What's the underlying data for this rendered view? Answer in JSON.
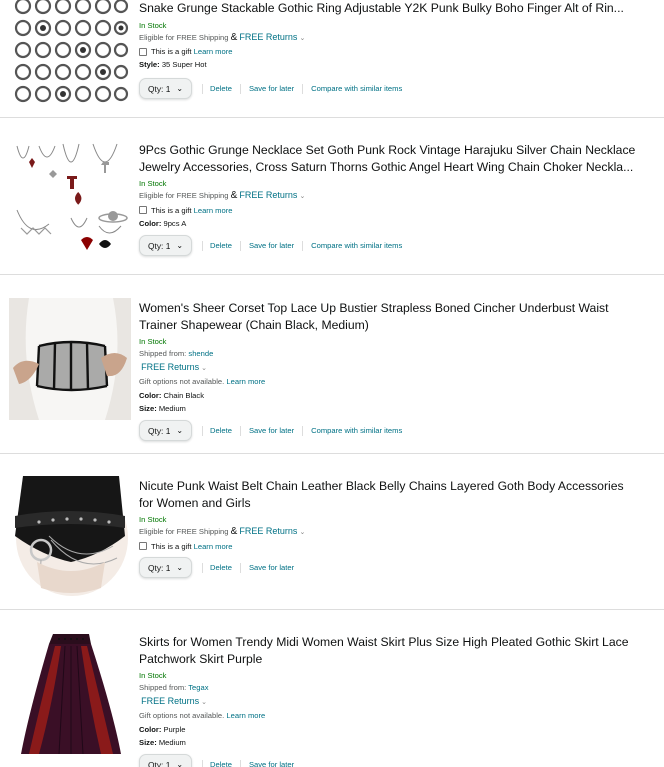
{
  "common": {
    "in_stock": "In Stock",
    "eligible": "Eligible for FREE Shipping",
    "amp": "&",
    "free_returns": "FREE Returns",
    "gift": "This is a gift",
    "learn_more": "Learn more",
    "gift_not_available": "Gift options not available.",
    "shipped_from": "Shipped from:",
    "qty_label": "Qty:",
    "delete": "Delete",
    "save_for_later": "Save for later",
    "compare": "Compare with similar items",
    "colors": {
      "link": "#007185",
      "in_stock": "#007600",
      "divider": "#dddddd"
    }
  },
  "items": [
    {
      "title": "Snake Grunge Stackable Gothic Ring Adjustable Y2K Punk Bulky Boho Finger Alt of Rin...",
      "attr_label": "Style:",
      "attr_value": "35 Super Hot",
      "qty": "1"
    },
    {
      "title": "9Pcs Gothic Grunge Necklace Set Goth Punk Rock Vintage Harajuku Silver Chain Necklace Jewelry Accessories, Cross Saturn Thorns Gothic Angel Heart Wing Chain Choker Neckla...",
      "attr_label": "Color:",
      "attr_value": "9pcs A",
      "qty": "1"
    },
    {
      "title": "Women's Sheer Corset Top Lace Up Bustier Strapless Boned Cincher Underbust Waist Trainer Shapewear (Chain Black, Medium)",
      "seller": "shende",
      "attr_label": "Color:",
      "attr_value": "Chain Black",
      "attr2_label": "Size:",
      "attr2_value": "Medium",
      "qty": "1"
    },
    {
      "title": "Nicute Punk Waist Belt Chain Leather Black Belly Chains Layered Goth Body Accessories for Women and Girls",
      "qty": "1"
    },
    {
      "title": "Skirts for Women Trendy Midi Women Waist Skirt Plus Size High Pleated Gothic Skirt Lace Patchwork Skirt Purple",
      "seller": "Tegax",
      "attr_label": "Color:",
      "attr_value": "Purple",
      "attr2_label": "Size:",
      "attr2_value": "Medium",
      "qty": "1"
    }
  ]
}
